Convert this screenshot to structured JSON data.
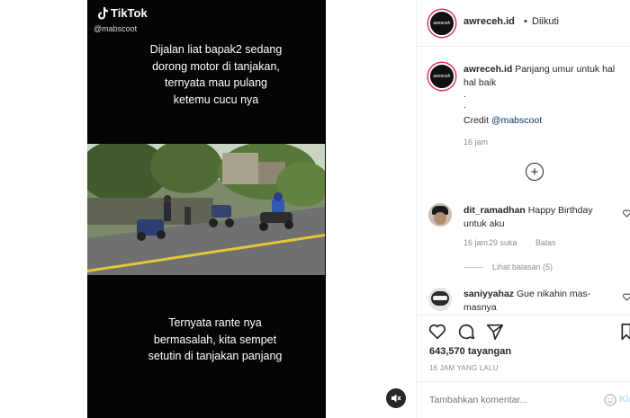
{
  "video": {
    "brand": "TikTok",
    "handle": "@mabscoot",
    "caption_top": "Dijalan liat bapak2 sedang\ndorong motor di tanjakan,\nternyata mau pulang\nketemu cucu nya",
    "caption_bottom": "Ternyata rante nya\nbermasalah, kita sempet\nsetutin di tanjakan panjang"
  },
  "header": {
    "username": "awreceh.id",
    "separator": "•",
    "follow_status": "Diikuti"
  },
  "post": {
    "username": "awreceh.id",
    "caption": "Panjang umur untuk hal hal baik",
    "dot1": ".",
    "dot2": ".",
    "credit_label": "Credit",
    "credit_handle": "@mabscoot",
    "time": "16 jam"
  },
  "comments": [
    {
      "username": "dit_ramadhan",
      "text": "Happy Birthday untuk aku",
      "time": "16 jam",
      "likes": "29 suka",
      "reply": "Balas",
      "view_replies": "Lihat balasan (5)"
    },
    {
      "username": "saniyyahaz",
      "text": "Gue nikahin mas-masnya"
    }
  ],
  "stats": {
    "views": "643,570 tayangan",
    "age": "16 JAM YANG LALU"
  },
  "add_comment": {
    "placeholder": "Tambahkan komentar...",
    "post_label": "Kirim"
  },
  "icons": [
    "tiktok-icon",
    "mute-icon",
    "plus-circle-icon",
    "heart-icon",
    "comment-icon",
    "share-icon",
    "bookmark-icon",
    "emoji-icon"
  ],
  "colors": {
    "story_ring": "#e1306c",
    "text": "#262626",
    "meta": "#8e8e8e",
    "link": "#00376b"
  }
}
